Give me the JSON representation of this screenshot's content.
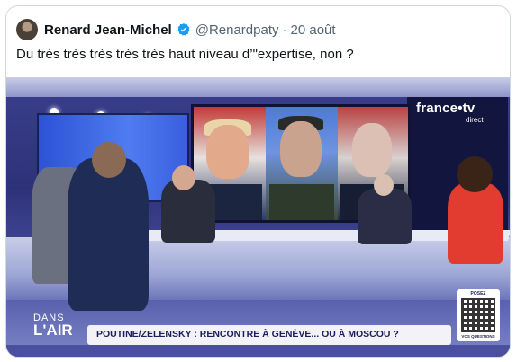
{
  "tweet": {
    "author_name": "Renard Jean-Michel",
    "handle": "@Renardpaty",
    "separator": "·",
    "date": "20 août",
    "text": "Du très très très très très haut niveau d’\"expertise, non ?",
    "verified_color": "#1d9bf0"
  },
  "media": {
    "channel_logo": "france•tv",
    "channel_sub": "direct",
    "show_name_top": "DANS",
    "show_name_bottom": "L'AIR",
    "ticker": "POUTINE/ZELENSKY : RENCONTRE À GENÈVE... OU À MOSCOU ?",
    "qr_top": "POSEZ",
    "qr_bottom": "VOS QUESTIONS"
  }
}
